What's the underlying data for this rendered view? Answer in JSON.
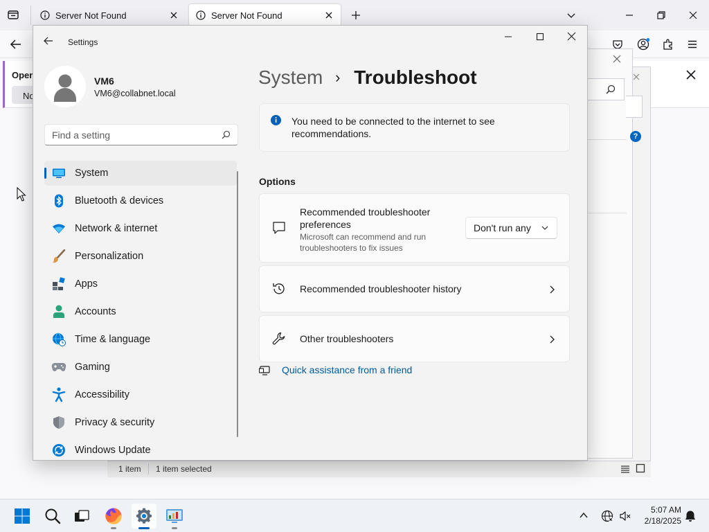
{
  "browser": {
    "tabs": [
      {
        "title": "Server Not Found"
      },
      {
        "title": "Server Not Found"
      }
    ]
  },
  "background": {
    "panel_title": "Open",
    "panel_subtitle": "No",
    "status": {
      "count": "1 item",
      "selected": "1 item selected"
    }
  },
  "settings": {
    "window_title": "Settings",
    "user": {
      "name": "VM6",
      "email": "VM6@collabnet.local"
    },
    "search": {
      "placeholder": "Find a setting"
    },
    "nav": [
      {
        "label": "System",
        "icon": "monitor-icon",
        "selected": true
      },
      {
        "label": "Bluetooth & devices",
        "icon": "bluetooth-icon"
      },
      {
        "label": "Network & internet",
        "icon": "wifi-icon"
      },
      {
        "label": "Personalization",
        "icon": "brush-icon"
      },
      {
        "label": "Apps",
        "icon": "apps-icon"
      },
      {
        "label": "Accounts",
        "icon": "person-icon"
      },
      {
        "label": "Time & language",
        "icon": "globe-clock-icon"
      },
      {
        "label": "Gaming",
        "icon": "gamepad-icon"
      },
      {
        "label": "Accessibility",
        "icon": "accessibility-icon"
      },
      {
        "label": "Privacy & security",
        "icon": "shield-icon"
      },
      {
        "label": "Windows Update",
        "icon": "update-icon"
      }
    ],
    "breadcrumb": {
      "parent": "System",
      "separator": "›",
      "current": "Troubleshoot"
    },
    "notice": "You need to be connected to the internet to see recommendations.",
    "options_heading": "Options",
    "preferences": {
      "title": "Recommended troubleshooter preferences",
      "description": "Microsoft can recommend and run troubleshooters to fix issues",
      "dropdown_value": "Don't run any"
    },
    "history_label": "Recommended troubleshooter history",
    "other_label": "Other troubleshooters",
    "quick_assist_link": "Quick assistance from a friend",
    "accent_color": "#005fb8",
    "link_color": "#005a9e"
  },
  "taskbar": {
    "time": "5:07 AM",
    "date": "2/18/2025"
  }
}
